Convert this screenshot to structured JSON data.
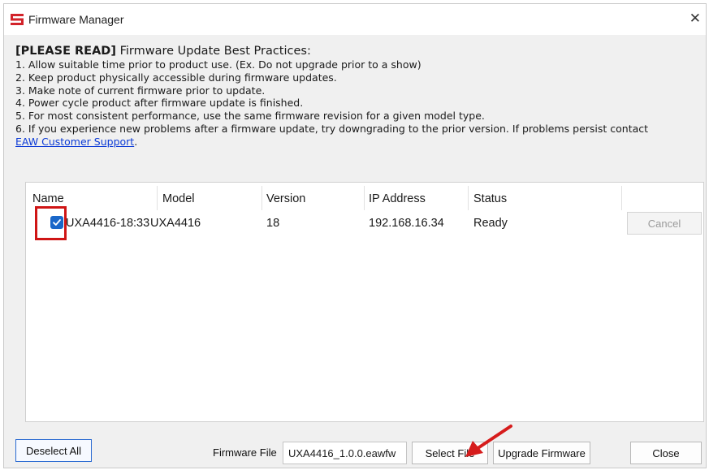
{
  "window": {
    "title": "Firmware Manager",
    "close_glyph": "✕"
  },
  "notes": {
    "heading_bold": "[PLEASE READ]",
    "heading_rest": " Firmware Update Best Practices:",
    "lines": [
      "1. Allow suitable time prior to product use. (Ex. Do not upgrade prior to a show)",
      "2. Keep product physically accessible during firmware updates.",
      "3. Make note of current firmware prior to update.",
      "4. Power cycle product after firmware update is finished.",
      "5. For most consistent performance, use the same firmware revision for a given model type.",
      "6. If you experience new problems after a firmware update, try downgrading to the prior version. If problems persist contact"
    ],
    "support_link": "EAW Customer Support",
    "support_suffix": "."
  },
  "table": {
    "columns": [
      "Name",
      "Model",
      "Version",
      "IP Address",
      "Status"
    ],
    "rows": [
      {
        "checked": true,
        "name": "UXA4416-18:33",
        "model": "UXA4416",
        "version": "18",
        "ip": "192.168.16.34",
        "status": "Ready",
        "action": "Cancel"
      }
    ]
  },
  "footer": {
    "deselect_all": "Deselect All",
    "firmware_file_label": "Firmware File",
    "firmware_file_value": "UXA4416_1.0.0.eawfw",
    "select_file": "Select File",
    "upgrade_firmware": "Upgrade Firmware",
    "close": "Close"
  },
  "colors": {
    "brand": "#d2232a",
    "accent_blue": "#1a67c9",
    "highlight_red": "#cf1515",
    "link": "#0b3ad6"
  }
}
